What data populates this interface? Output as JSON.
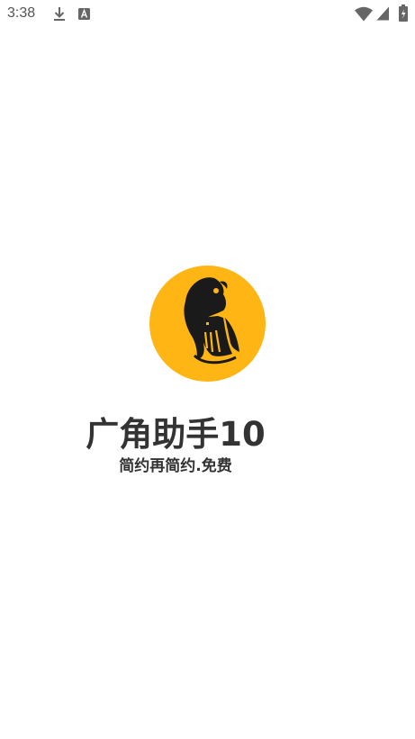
{
  "status_bar": {
    "time": "3:38",
    "icons": [
      "download-icon",
      "keyboard-a-icon",
      "wifi-icon",
      "signal-icon",
      "battery-icon"
    ]
  },
  "splash": {
    "logo": "app-logo",
    "logo_color": "#FFB514",
    "app_name": "广角助手10",
    "slogan": "简约再简约.免费"
  }
}
